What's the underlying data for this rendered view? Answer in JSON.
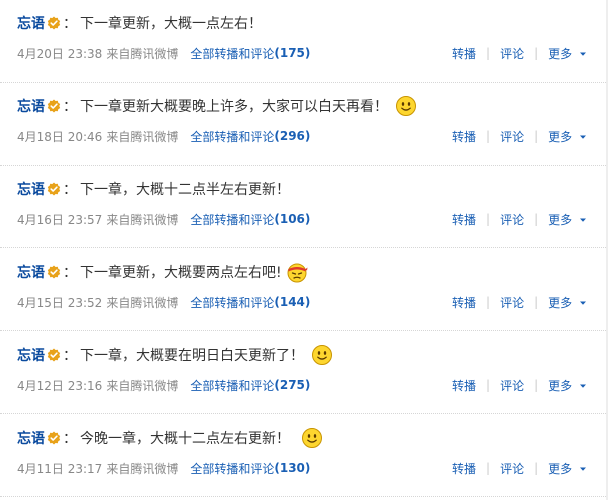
{
  "feed": {
    "posts": [
      {
        "author": "忘语",
        "colon": "：",
        "content": "下一章更新，大概一点左右！",
        "emoticon": "",
        "timestamp": "4月20日 23:38",
        "from": "来自",
        "source": "腾讯微博",
        "all_reposts": "全部转播和评论",
        "count": "(175)",
        "repost": "转播",
        "comment": "评论",
        "more": "更多"
      },
      {
        "author": "忘语",
        "colon": "：",
        "content": "下一章更新大概要晚上许多，大家可以白天再看！",
        "emoticon": "smile-emoticon",
        "timestamp": "4月18日 20:46",
        "from": "来自",
        "source": "腾讯微博",
        "all_reposts": "全部转播和评论",
        "count": "(296)",
        "repost": "转播",
        "comment": "评论",
        "more": "更多"
      },
      {
        "author": "忘语",
        "colon": "：",
        "content": "下一章，大概十二点半左右更新！",
        "emoticon": "",
        "timestamp": "4月16日 23:57",
        "from": "来自",
        "source": "腾讯微博",
        "all_reposts": "全部转播和评论",
        "count": "(106)",
        "repost": "转播",
        "comment": "评论",
        "more": "更多"
      },
      {
        "author": "忘语",
        "colon": "：",
        "content": "下一章更新，大概要两点左右吧!",
        "emoticon": "headband-emoticon",
        "timestamp": "4月15日 23:52",
        "from": "来自",
        "source": "腾讯微博",
        "all_reposts": "全部转播和评论",
        "count": "(144)",
        "repost": "转播",
        "comment": "评论",
        "more": "更多"
      },
      {
        "author": "忘语",
        "colon": "：",
        "content": "下一章，大概要在明日白天更新了！",
        "emoticon": "smile-emoticon",
        "timestamp": "4月12日 23:16",
        "from": "来自",
        "source": "腾讯微博",
        "all_reposts": "全部转播和评论",
        "count": "(275)",
        "repost": "转播",
        "comment": "评论",
        "more": "更多"
      },
      {
        "author": "忘语",
        "colon": "：",
        "content": "今晚一章，大概十二点左右更新！",
        "emoticon": "smile-emoticon",
        "timestamp": "4月11日 23:17",
        "from": "来自",
        "source": "腾讯微博",
        "all_reposts": "全部转播和评论",
        "count": "(130)",
        "repost": "转播",
        "comment": "评论",
        "more": "更多"
      }
    ]
  },
  "colors": {
    "author": "#0a4a9e",
    "link": "#1a5fb4",
    "meta": "#888888",
    "badge": "#e8a21a"
  },
  "icons": {
    "verified": "verified-badge-icon",
    "more": "chevron-down-icon"
  }
}
